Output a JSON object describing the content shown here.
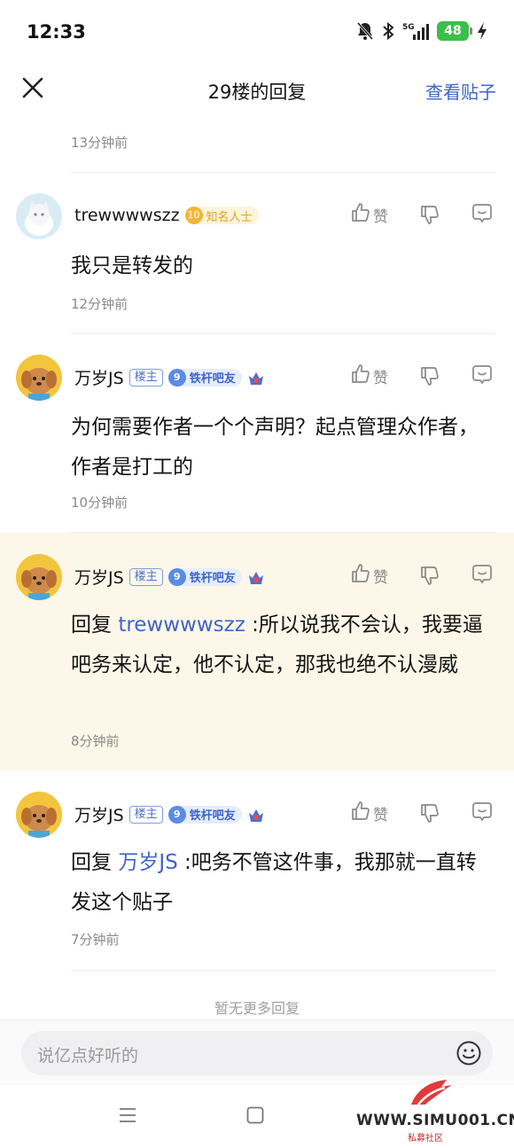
{
  "status_bar": {
    "time": "12:33",
    "network": "5G",
    "battery": "48",
    "icons": [
      "bell-muted-icon",
      "bluetooth-icon",
      "signal-icon",
      "battery-icon",
      "charging-icon"
    ]
  },
  "nav": {
    "title": "29楼的回复",
    "action": "查看贴子",
    "close_icon": "close-icon"
  },
  "top_time": "13分钟前",
  "comments": [
    {
      "username": "trewwwwszz",
      "badges": {
        "famous_level": "10",
        "famous_label": "知名人士"
      },
      "like_label": "赞",
      "text": "我只是转发的",
      "time": "12分钟前"
    },
    {
      "username": "万岁JS",
      "badges": {
        "owner": "楼主",
        "fan_level": "9",
        "fan_label": "铁杆吧友"
      },
      "like_label": "赞",
      "text": "为何需要作者一个个声明？起点管理众作者，作者是打工的",
      "time": "10分钟前"
    },
    {
      "username": "万岁JS",
      "badges": {
        "owner": "楼主",
        "fan_level": "9",
        "fan_label": "铁杆吧友"
      },
      "like_label": "赞",
      "reply_prefix": "回复",
      "mention": "trewwwwszz",
      "text": " :所以说我不会认，我要逼吧务来认定，他不认定，那我也绝不认漫威",
      "time": "8分钟前"
    },
    {
      "username": "万岁JS",
      "badges": {
        "owner": "楼主",
        "fan_level": "9",
        "fan_label": "铁杆吧友"
      },
      "like_label": "赞",
      "reply_prefix": "回复",
      "mention": "万岁JS",
      "text": " :吧务不管这件事，我那就一直转发这个贴子",
      "time": "7分钟前"
    }
  ],
  "no_more": "暂无更多回复",
  "input": {
    "placeholder": "说亿点好听的"
  },
  "watermark": {
    "text": "WWW.SIMU001.CN",
    "sub": "私募社区"
  },
  "colors": {
    "accent": "#3d64c8",
    "highlight_bg": "#fcf7e8",
    "famous": "#e2a21c"
  }
}
